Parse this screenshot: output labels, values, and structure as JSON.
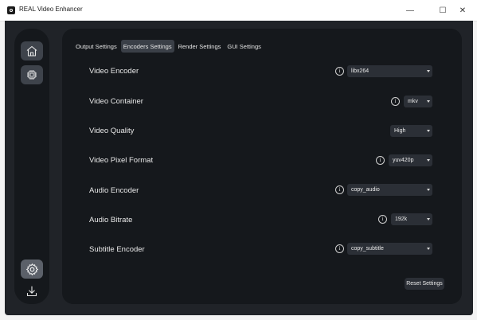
{
  "window": {
    "title": "REAL Video Enhancer",
    "controls": {
      "minimize": "—",
      "maximize": "☐",
      "close": "✕"
    }
  },
  "sidebar": {
    "items": [
      {
        "name": "home",
        "icon": "home-icon",
        "selected": false
      },
      {
        "name": "processing",
        "icon": "chip-icon",
        "selected": false
      },
      {
        "name": "settings",
        "icon": "gear-icon",
        "selected": true
      },
      {
        "name": "download",
        "icon": "download-icon",
        "selected": false
      }
    ]
  },
  "tabs": [
    {
      "label": "Output Settings",
      "active": false
    },
    {
      "label": "Encoders Settings",
      "active": true
    },
    {
      "label": "Render Settings",
      "active": false
    },
    {
      "label": "GUI Settings",
      "active": false
    }
  ],
  "settings": [
    {
      "label": "Video Encoder",
      "value": "libx264"
    },
    {
      "label": "Video Container",
      "value": "mkv"
    },
    {
      "label": "Video Quality",
      "value": "High"
    },
    {
      "label": "Video Pixel Format",
      "value": "yuv420p"
    },
    {
      "label": "Audio Encoder",
      "value": "copy_audio"
    },
    {
      "label": "Audio Bitrate",
      "value": "192k"
    },
    {
      "label": "Subtitle Encoder",
      "value": "copy_subtitle"
    }
  ],
  "info_symbol": "i",
  "reset_label": "Reset Settings",
  "colors": {
    "window_bg": "#202328",
    "panel_bg": "#15181c",
    "control_bg": "#2b2f36",
    "selected_sidebar": "#5b6069"
  }
}
